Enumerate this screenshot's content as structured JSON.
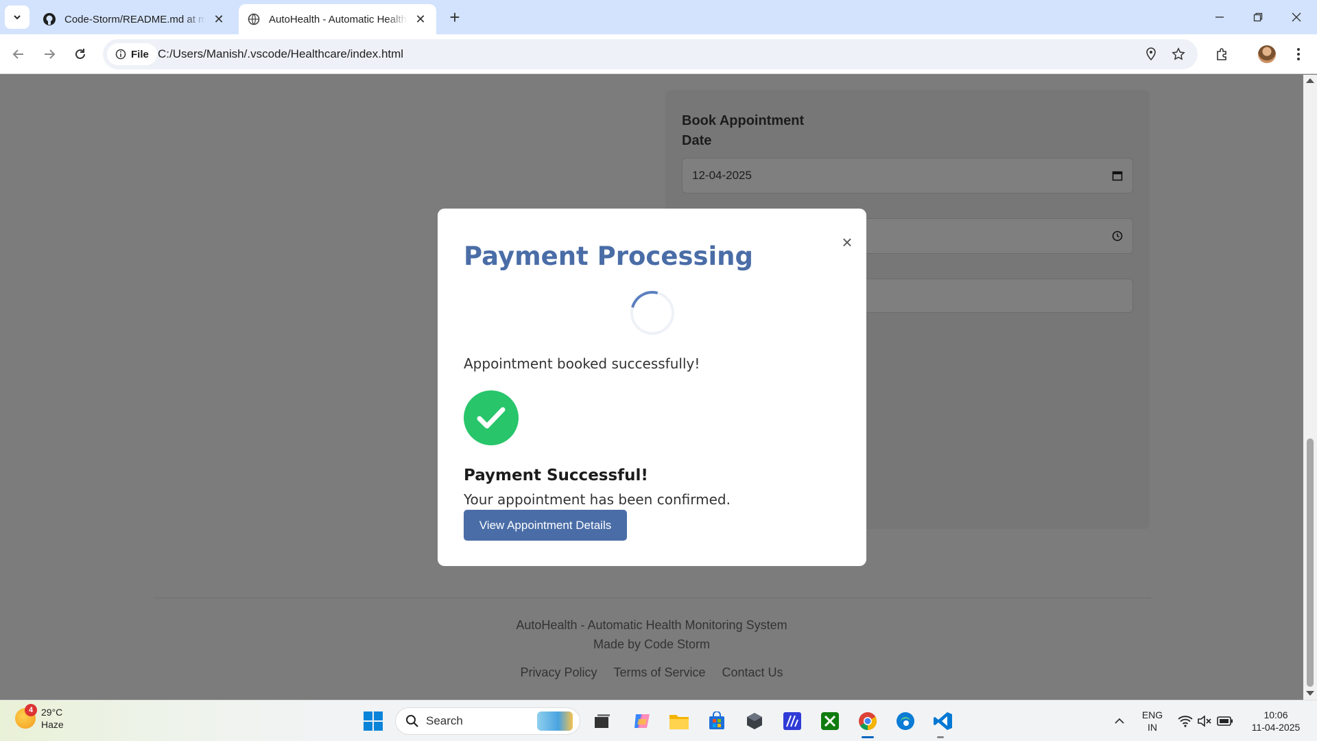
{
  "browser": {
    "tabs": [
      {
        "title": "Code-Storm/README.md at main",
        "icon": "github-icon",
        "active": false
      },
      {
        "title": "AutoHealth - Automatic Health Monitoring",
        "icon": "globe-icon",
        "active": true
      }
    ],
    "address": {
      "chip": "File",
      "url": "C:/Users/Manish/.vscode/Healthcare/index.html"
    }
  },
  "form": {
    "heading": "Book Appointment",
    "date_label": "Date",
    "date_value": "12-04-2025"
  },
  "modal": {
    "title": "Payment Processing",
    "message": "Appointment booked successfully!",
    "success_title": "Payment Successful!",
    "success_subtitle": "Your appointment has been confirmed.",
    "button_label": "View Appointment Details",
    "close_symbol": "×"
  },
  "footer": {
    "line1": "AutoHealth - Automatic Health Monitoring System",
    "line2": "Made by Code Storm",
    "links": [
      "Privacy Policy",
      "Terms of Service",
      "Contact Us"
    ]
  },
  "taskbar": {
    "weather": {
      "temp": "29°C",
      "condition": "Haze",
      "badge": "4"
    },
    "search_placeholder": "Search",
    "language": {
      "line1": "ENG",
      "line2": "IN"
    },
    "clock": {
      "time": "10:06",
      "date": "11-04-2025"
    }
  },
  "colors": {
    "accent": "#4a6da7",
    "success": "#28c56b",
    "overlay": "#7c7c7c"
  }
}
